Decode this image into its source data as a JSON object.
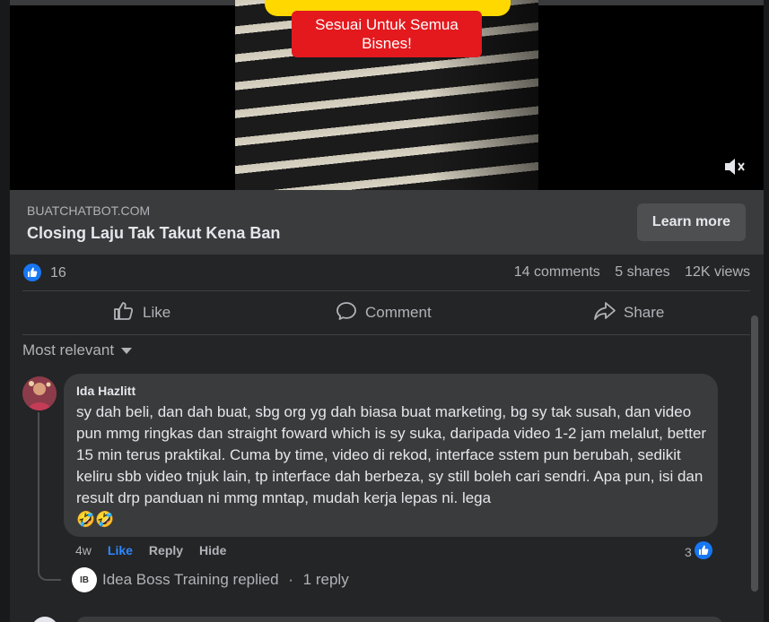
{
  "video": {
    "banner_text": "Sesuai Untuk Semua Bisnes!",
    "mute_icon": "speaker-muted-icon"
  },
  "link_card": {
    "domain": "BUATCHATBOT.COM",
    "headline": "Closing Laju Tak Takut Kena Ban",
    "cta_label": "Learn more"
  },
  "stats": {
    "reaction_count": "16",
    "comments": "14 comments",
    "shares": "5 shares",
    "views": "12K views"
  },
  "actions": {
    "like": "Like",
    "comment": "Comment",
    "share": "Share"
  },
  "sort": {
    "label": "Most relevant"
  },
  "comment": {
    "author": "Ida Hazlitt",
    "text": "sy dah beli, dan dah buat, sbg org yg dah biasa buat marketing, bg sy tak susah, dan video pun mmg ringkas dan straight foward which is sy suka, daripada video 1-2 jam melalut, better 15 min terus praktikal. Cuma by time, video di rekod, interface sstem pun berubah, sedikit keliru sbb video tnjuk lain, tp interface dah berbeza, sy still boleh cari sendri. Apa pun, isi dan result drp panduan ni mmg mntap, mudah kerja lepas ni. lega",
    "emoji": "🤣🤣",
    "time": "4w",
    "like_label": "Like",
    "reply_label": "Reply",
    "hide_label": "Hide",
    "reaction_count": "3"
  },
  "reply": {
    "avatar_text": "IB",
    "name": "Idea Boss Training replied",
    "separator": " · ",
    "count": "1 reply"
  },
  "colors": {
    "accent": "#1877f2",
    "background": "#242526",
    "surface": "#3a3b3c",
    "banner_red": "#e3191e",
    "banner_yellow": "#ffd800"
  }
}
